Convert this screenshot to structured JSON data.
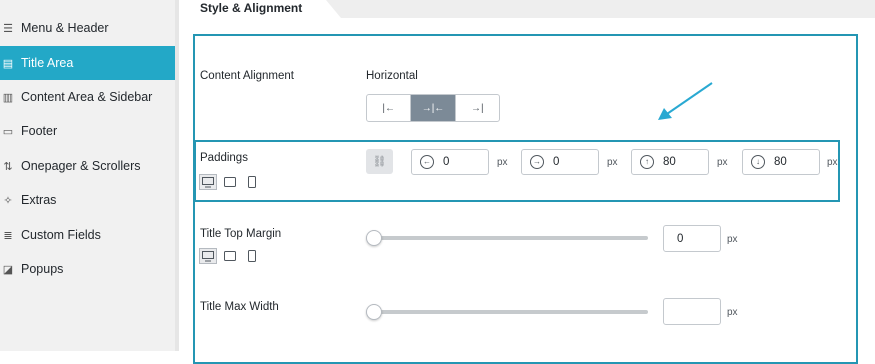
{
  "sidebar": {
    "items": [
      {
        "label": "Menu & Header",
        "icon": "menu-header-icon",
        "glyph": "☰",
        "active": false
      },
      {
        "label": "Title Area",
        "icon": "title-area-icon",
        "glyph": "▤",
        "active": true
      },
      {
        "label": "Content Area & Sidebar",
        "icon": "content-area-icon",
        "glyph": "▥",
        "active": false
      },
      {
        "label": "Footer",
        "icon": "footer-icon",
        "glyph": "▭",
        "active": false
      },
      {
        "label": "Onepager & Scrollers",
        "icon": "onepager-icon",
        "glyph": "⇅",
        "active": false
      },
      {
        "label": "Extras",
        "icon": "extras-icon",
        "glyph": "✧",
        "active": false
      },
      {
        "label": "Custom Fields",
        "icon": "custom-fields-icon",
        "glyph": "≣",
        "active": false
      },
      {
        "label": "Popups",
        "icon": "popups-icon",
        "glyph": "◪",
        "active": false
      }
    ]
  },
  "tab": {
    "label": "Style & Alignment"
  },
  "content_alignment": {
    "label": "Content Alignment",
    "sublabel": "Horizontal",
    "options": [
      {
        "glyph": "|←",
        "icon": "align-left-icon",
        "active": false
      },
      {
        "glyph": "→|←",
        "icon": "align-center-icon",
        "active": true
      },
      {
        "glyph": "→|",
        "icon": "align-right-icon",
        "active": false
      }
    ]
  },
  "paddings": {
    "label": "Paddings",
    "link_glyph": "⛓",
    "fields": [
      {
        "name": "left",
        "arrow": "←",
        "value": "0",
        "unit": "px"
      },
      {
        "name": "right",
        "arrow": "→",
        "value": "0",
        "unit": "px"
      },
      {
        "name": "top",
        "arrow": "↑",
        "value": "80",
        "unit": "px"
      },
      {
        "name": "bottom",
        "arrow": "↓",
        "value": "80",
        "unit": "px"
      }
    ]
  },
  "title_top_margin": {
    "label": "Title Top Margin",
    "value": "0",
    "unit": "px",
    "slider_fraction": 0
  },
  "title_max_width": {
    "label": "Title Max Width",
    "value": "",
    "unit": "px",
    "slider_fraction": 0
  },
  "colors": {
    "accent": "#23a8c7",
    "highlight_border": "#2496b3",
    "annotation_arrow": "#29a9d2"
  }
}
